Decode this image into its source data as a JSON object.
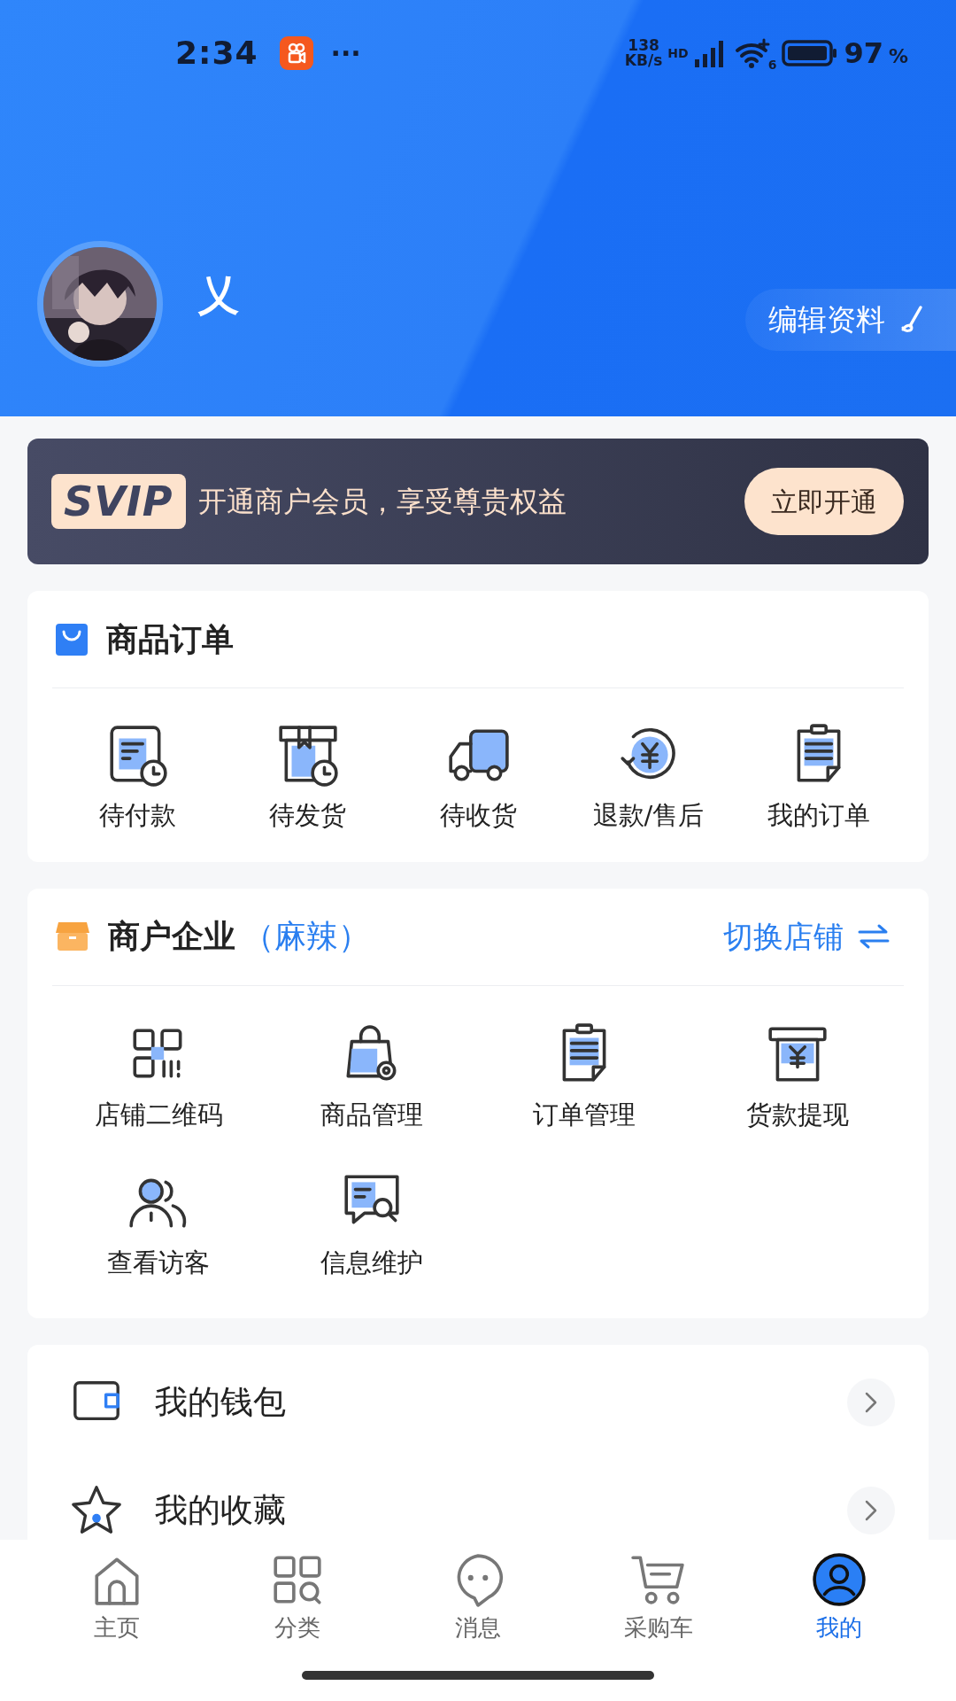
{
  "status_bar": {
    "time": "2:34",
    "more": "···",
    "speed_value": "138",
    "speed_unit": "KB/s",
    "hd": "HD",
    "wifi_label": "6",
    "battery": "97",
    "battery_unit": "%"
  },
  "profile": {
    "name": "乂",
    "edit_button": "编辑资料"
  },
  "vip_banner": {
    "badge": "SVIP",
    "text": "开通商户会员，享受尊贵权益",
    "button": "立即开通"
  },
  "orders": {
    "title": "商品订单",
    "items": [
      {
        "label": "待付款"
      },
      {
        "label": "待发货"
      },
      {
        "label": "待收货"
      },
      {
        "label": "退款/售后"
      },
      {
        "label": "我的订单"
      }
    ]
  },
  "merchant": {
    "title": "商户企业",
    "shop": "（麻辣）",
    "switch_link": "切换店铺",
    "items": [
      {
        "label": "店铺二维码"
      },
      {
        "label": "商品管理"
      },
      {
        "label": "订单管理"
      },
      {
        "label": "货款提现"
      },
      {
        "label": "查看访客"
      },
      {
        "label": "信息维护"
      }
    ]
  },
  "menu": [
    {
      "label": "我的钱包"
    },
    {
      "label": "我的收藏"
    }
  ],
  "tab_bar": [
    {
      "label": "主页",
      "selected": false
    },
    {
      "label": "分类",
      "selected": false
    },
    {
      "label": "消息",
      "selected": false
    },
    {
      "label": "采购车",
      "selected": false
    },
    {
      "label": "我的",
      "selected": true
    }
  ]
}
